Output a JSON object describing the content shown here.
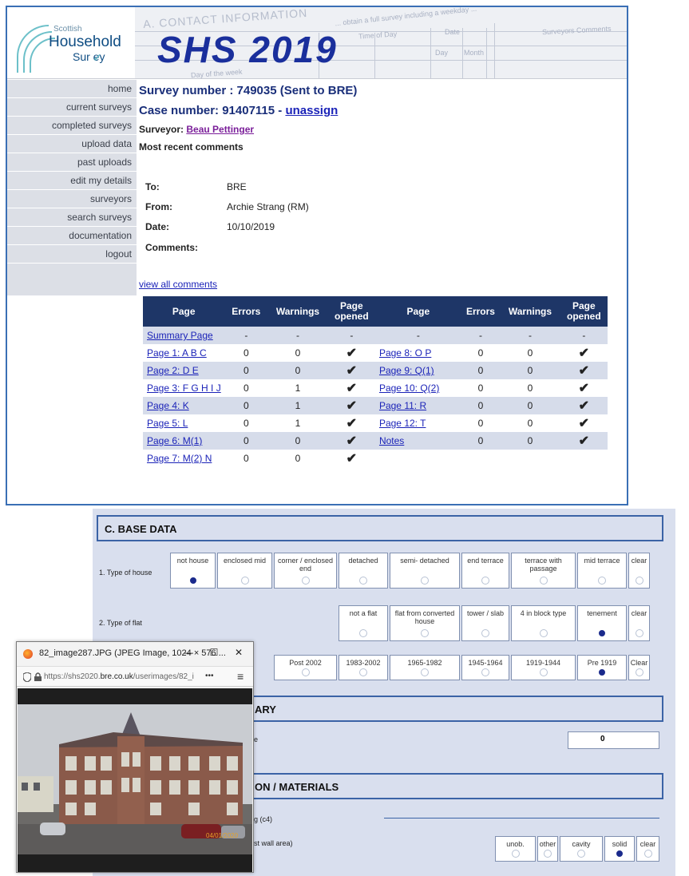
{
  "logo": {
    "line1": "Scottish",
    "line2": "Household",
    "line3": "Sur  ey"
  },
  "banner": {
    "title": "SHS 2019",
    "form_section": "A. CONTACT INFORMATION",
    "form_hint": "... obtain a full survey including a weekday ...",
    "form_labels": [
      "Time of Day",
      "Date",
      "Day",
      "Month",
      "Surveyors Comments",
      "Day of the week"
    ]
  },
  "nav": [
    "home",
    "current surveys",
    "completed surveys",
    "upload data",
    "past uploads",
    "edit my details",
    "surveyors",
    "search surveys",
    "documentation",
    "logout"
  ],
  "main": {
    "survey_number": "Survey number : 749035 (Sent to BRE)",
    "case_number": "Case number: 91407115 - ",
    "unassign": "unassign",
    "surveyor_label": "Surveyor: ",
    "surveyor_name": "Beau Pettinger",
    "recent_comments": "Most recent comments",
    "to_label": "To:",
    "to_value": "BRE",
    "from_label": "From:",
    "from_value": "Archie Strang (RM)",
    "date_label": "Date:",
    "date_value": "10/10/2019",
    "comments_label": "Comments:",
    "view_all": "view all comments"
  },
  "table": {
    "headers": [
      "Page",
      "Errors",
      "Warnings",
      "Page opened",
      "Page",
      "Errors",
      "Warnings",
      "Page opened"
    ],
    "rows": [
      [
        "Summary Page",
        "-",
        "-",
        "-",
        "-",
        "-",
        "-",
        "-"
      ],
      [
        "Page 1: A B C",
        "0",
        "0",
        "✔",
        "Page 8: O P",
        "0",
        "0",
        "✔"
      ],
      [
        "Page 2: D E",
        "0",
        "0",
        "✔",
        "Page 9: Q(1)",
        "0",
        "0",
        "✔"
      ],
      [
        "Page 3: F G H I J",
        "0",
        "1",
        "✔",
        "Page 10: Q(2)",
        "0",
        "0",
        "✔"
      ],
      [
        "Page 4: K",
        "0",
        "1",
        "✔",
        "Page 11: R",
        "0",
        "0",
        "✔"
      ],
      [
        "Page 5: L",
        "0",
        "1",
        "✔",
        "Page 12: T",
        "0",
        "0",
        "✔"
      ],
      [
        "Page 6: M(1)",
        "0",
        "0",
        "✔",
        "Notes",
        "0",
        "0",
        "✔"
      ],
      [
        "Page 7: M(2) N",
        "0",
        "0",
        "✔",
        "",
        "",
        "",
        ""
      ]
    ]
  },
  "form": {
    "section_c": "C. BASE DATA",
    "row1_label": "1. Type of house",
    "house_options": [
      "not house",
      "enclosed mid",
      "corner / enclosed end",
      "detached",
      "semi- detached",
      "end terrace",
      "terrace with passage",
      "mid terrace",
      "clear"
    ],
    "house_selected": 0,
    "row2_label": "2. Type of flat",
    "flat_options": [
      "not a flat",
      "flat from converted house",
      "tower / slab",
      "4 in block type",
      "tenement",
      "clear"
    ],
    "flat_selected": 4,
    "age_options": [
      "Post 2002",
      "1983-2002",
      "1965-1982",
      "1945-1964",
      "1919-1944",
      "Pre 1919",
      "Clear"
    ],
    "age_selected": 5,
    "section_d": "ARY",
    "d_row_label": "e",
    "d_value": "0",
    "section_e": "ON / MATERIALS",
    "e_row1": "g (c4)",
    "e_row2": "st wall area)",
    "wall_options": [
      "unob.",
      "other",
      "cavity",
      "solid",
      "clear"
    ],
    "wall_selected": 3
  },
  "popup": {
    "title": "82_image287.JPG (JPEG Image, 1024 × 576 ...",
    "url_prefix": "https://shs2020.",
    "url_domain": "bre.co.uk",
    "url_suffix": "/userimages/82_i",
    "menu_dots": "•••",
    "menu": "≡",
    "minimize": "—",
    "maximize": "☐",
    "close": "✕",
    "photo_date": "04/01/2020"
  }
}
